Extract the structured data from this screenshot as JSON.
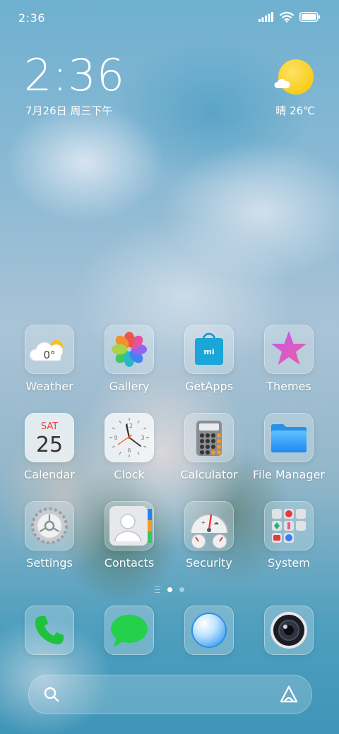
{
  "status_bar": {
    "time": "2:36"
  },
  "clock_widget": {
    "time": "2:36",
    "date": "7月26日 周三下午"
  },
  "weather_widget": {
    "text": "晴 26℃"
  },
  "apps": [
    {
      "label": "Weather",
      "icon": "weather-icon",
      "badge_text": "0°"
    },
    {
      "label": "Gallery",
      "icon": "gallery-icon"
    },
    {
      "label": "GetApps",
      "icon": "getapps-icon",
      "badge_text": "mi"
    },
    {
      "label": "Themes",
      "icon": "themes-icon"
    },
    {
      "label": "Calendar",
      "icon": "calendar-icon",
      "day_name": "SAT",
      "day_number": "25"
    },
    {
      "label": "Clock",
      "icon": "clock-icon",
      "numerals": [
        "12",
        "3",
        "6",
        "9"
      ]
    },
    {
      "label": "Calculator",
      "icon": "calculator-icon"
    },
    {
      "label": "File Manager",
      "icon": "folder-icon"
    },
    {
      "label": "Settings",
      "icon": "gear-icon"
    },
    {
      "label": "Contacts",
      "icon": "contacts-icon"
    },
    {
      "label": "Security",
      "icon": "security-icon"
    },
    {
      "label": "System",
      "icon": "system-folder-icon"
    }
  ],
  "page_indicator": {
    "pages": 2,
    "current": 1
  },
  "dock": [
    {
      "icon": "phone-icon"
    },
    {
      "icon": "messages-icon"
    },
    {
      "icon": "browser-icon"
    },
    {
      "icon": "camera-icon"
    }
  ],
  "colors": {
    "sun": "#f5c400",
    "phone_green": "#1fc23c",
    "messages_green": "#25d04a",
    "calendar_red": "#f04040",
    "getapps_blue": "#1aa6d8"
  }
}
